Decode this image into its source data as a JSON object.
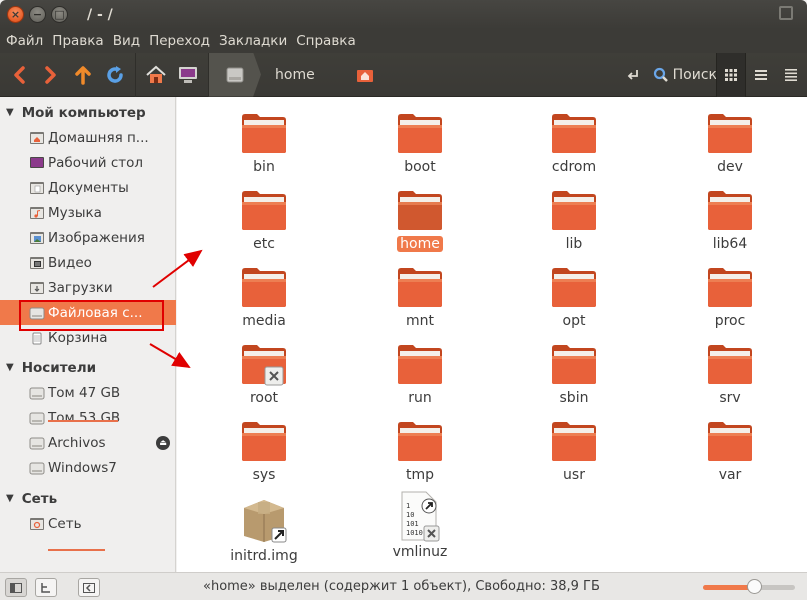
{
  "window": {
    "title": "/ - /"
  },
  "menu": [
    "Файл",
    "Правка",
    "Вид",
    "Переход",
    "Закладки",
    "Справка"
  ],
  "toolbar": {
    "path_crumb": "home",
    "search_label": "Поиск"
  },
  "sidebar": {
    "sections": [
      {
        "title": "Мой компьютер",
        "items": [
          {
            "label": "Домашняя п...",
            "icon": "home-folder-icon"
          },
          {
            "label": "Рабочий стол",
            "icon": "desktop-icon"
          },
          {
            "label": "Документы",
            "icon": "documents-folder-icon"
          },
          {
            "label": "Музыка",
            "icon": "music-folder-icon"
          },
          {
            "label": "Изображения",
            "icon": "pictures-folder-icon"
          },
          {
            "label": "Видео",
            "icon": "videos-folder-icon"
          },
          {
            "label": "Загрузки",
            "icon": "downloads-folder-icon"
          },
          {
            "label": "Файловая с...",
            "icon": "filesystem-drive-icon",
            "selected": true
          },
          {
            "label": "Корзина",
            "icon": "trash-icon"
          }
        ]
      },
      {
        "title": "Носители",
        "items": [
          {
            "label": "Том 47 GB",
            "icon": "drive-icon"
          },
          {
            "label": "Том 53 GB",
            "icon": "drive-icon"
          },
          {
            "label": "Archivos",
            "icon": "drive-icon",
            "eject": true
          },
          {
            "label": "Windows7",
            "icon": "drive-icon"
          }
        ]
      },
      {
        "title": "Сеть",
        "items": [
          {
            "label": "Сеть",
            "icon": "network-icon"
          }
        ]
      }
    ]
  },
  "files": [
    {
      "name": "bin",
      "type": "folder"
    },
    {
      "name": "boot",
      "type": "folder"
    },
    {
      "name": "cdrom",
      "type": "folder"
    },
    {
      "name": "dev",
      "type": "folder"
    },
    {
      "name": "etc",
      "type": "folder"
    },
    {
      "name": "home",
      "type": "folder",
      "selected": true
    },
    {
      "name": "lib",
      "type": "folder"
    },
    {
      "name": "lib64",
      "type": "folder"
    },
    {
      "name": "media",
      "type": "folder"
    },
    {
      "name": "mnt",
      "type": "folder"
    },
    {
      "name": "opt",
      "type": "folder"
    },
    {
      "name": "proc",
      "type": "folder"
    },
    {
      "name": "root",
      "type": "folder-locked"
    },
    {
      "name": "run",
      "type": "folder"
    },
    {
      "name": "sbin",
      "type": "folder"
    },
    {
      "name": "srv",
      "type": "folder"
    },
    {
      "name": "sys",
      "type": "folder"
    },
    {
      "name": "tmp",
      "type": "folder"
    },
    {
      "name": "usr",
      "type": "folder"
    },
    {
      "name": "var",
      "type": "folder"
    },
    {
      "name": "initrd.img",
      "type": "package-link"
    },
    {
      "name": "vmlinuz",
      "type": "binary-link"
    }
  ],
  "status": {
    "text": "«home» выделен (содержит 1 объект), Свободно: 38,9 ГБ",
    "zoom": 0.55
  },
  "colors": {
    "accent": "#f0794a",
    "folder": "#e8613a",
    "annotation": "#e00000"
  }
}
